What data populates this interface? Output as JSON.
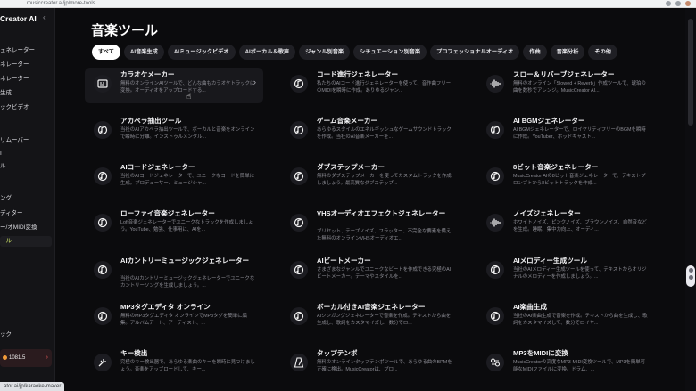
{
  "browser": {
    "url": "musiccreator.ai/jp/more-tools"
  },
  "status_url": "ator.ai/jp/karaoke-maker",
  "sidebar": {
    "brand": "Creator AI",
    "items": [
      {
        "label": "ェネレーター"
      },
      {
        "label": "ネレーター"
      },
      {
        "label": "ネレーター"
      },
      {
        "label": "生成"
      },
      {
        "label": "ックビデオ"
      },
      {
        "label": "リムーバー"
      },
      {
        "label": "I"
      },
      {
        "label": "ル"
      },
      {
        "label": "ング"
      },
      {
        "label": "ディター"
      },
      {
        "label": "ー/オMIDI変換"
      },
      {
        "label": "ール"
      },
      {
        "label": "ック"
      }
    ],
    "credits": "1081.5"
  },
  "main": {
    "title": "音楽ツール",
    "filters": [
      "すべて",
      "AI音楽生成",
      "AIミュージックビデオ",
      "AIボーカル＆歌声",
      "ジャンル別音楽",
      "シチュエーション別音楽",
      "プロフェッショナルオーディオ",
      "作曲",
      "音楽分析",
      "その他"
    ],
    "tools": [
      {
        "title": "カラオケメーカー",
        "desc": "無料のオンラインAIツールで、どんな曲もカラオケトラックに変換。オーディオをアップロードする...",
        "icon": "karaoke-icon"
      },
      {
        "title": "コード進行ジェネレーター",
        "desc": "私たちのAIコード進行ジェネレーターを使って、音作曲フリーのMIDIを瞬時に作成。ありゆるジャン...",
        "icon": "music-note-icon"
      },
      {
        "title": "スロー＆リバーブジェネレーター",
        "desc": "無料のオンライン「Slowed + Reverb」作成ツールで、琥珀の曲を数秒でアレンジ。MusicCreator AI...",
        "icon": "waveform-icon"
      },
      {
        "title": "アカペラ抽出ツール",
        "desc": "当社のAIアカペラ抽出ツールで、ボーカルと音楽をオンラインで瞬時に分離。インストゥルメンタル...",
        "icon": "music-note-icon"
      },
      {
        "title": "ゲーム音楽メーカー",
        "desc": "あらゆるスタイルのエネルギッシュなゲームサウンドトラックを作成。当社のAI音楽メーカーを...",
        "icon": "music-note-icon"
      },
      {
        "title": "AI BGMジェネレーター",
        "desc": "AI BGMジェネレーターで、ロイヤリティフリーのBGMを瞬時に作成。YouTuber、ポッドキャスト...",
        "icon": "music-note-icon"
      },
      {
        "title": "AIコードジェネレーター",
        "desc": "当社のAIコードジェネレーターで、ユニークなコードを簡単に生成。プロデューサー、ミュージシャ...",
        "icon": "music-note-icon"
      },
      {
        "title": "ダブステップメーカー",
        "desc": "無料のダブステップメーカーを使ってカスタムトラックを作成しましょう。最高質なダブステップ...",
        "icon": "music-note-icon"
      },
      {
        "title": "8ビット音楽ジェネレーター",
        "desc": "MusicCreator AIの8ビット音楽ジェネレーターで、テキストプロンプトから8ビットトラックを作成...",
        "icon": "music-note-icon"
      },
      {
        "title": "ローファイ音楽ジェネレーター",
        "desc": "Lofi音楽ジェネレーターでユニークなトラックを作成しましょう。YouTube、勉強、仕事用に、AIを...",
        "icon": "music-note-icon"
      },
      {
        "title": "VHSオーディオエフェクトジェネレーター",
        "desc": "ブリセット、テープノイズ、フラッター、不完全な要素を備えた無料のオンラインVHSオーディオエ...",
        "icon": "music-note-icon"
      },
      {
        "title": "ノイズジェネレーター",
        "desc": "ホワイトノイズ、ピンクノイズ、ブラウンノイズ、自然音などを生成。睡眠、集中力向上、オーディ...",
        "icon": "waveform-icon"
      },
      {
        "title": "AIカントリーミュージックジェネレーター",
        "desc": "当社のAIカントリーミュージックジェネレーターでユニークなカントリーソングを生成しましょう。...",
        "icon": "music-note-icon"
      },
      {
        "title": "AIビートメーカー",
        "desc": "さまざまなジャンルでユニークなビートを作成できる究極のAIビートメーカー。テーマやスタイルを...",
        "icon": "music-note-icon"
      },
      {
        "title": "AIメロディー生成ツール",
        "desc": "当社のAIメロディー生成ツールを使って、テキストからオリジナルのメロディーを作成しましょう。...",
        "icon": "music-note-icon"
      },
      {
        "title": "MP3タグエディタ オンライン",
        "desc": "無料のMP3タグエディタ オンラインでMP3タグを簡単に編集。アルバムアート、アーティスト、...",
        "icon": "music-note-icon"
      },
      {
        "title": "ボーカル付きAI音楽ジェネレーター",
        "desc": "AIシンガングジェネレーターで音楽を作成。テキストから曲を生成し、歌詞をカスタマイズし、数分でロ...",
        "icon": "music-note-icon"
      },
      {
        "title": "AI楽曲生成",
        "desc": "当社のAI楽曲生成で音楽を作成。テキストから曲を生成し、歌詞をカスタマイズして、数分でロイヤ...",
        "icon": "music-note-icon"
      },
      {
        "title": "キー検出",
        "desc": "究極のキー検出器で、あらゆる楽曲のキーを瞬時に見つけましょう。音楽をアップロードして、キー...",
        "icon": "tuning-icon"
      },
      {
        "title": "タップテンポ",
        "desc": "無料のオンラインタップテンポツールで、あらゆる曲のBPMを正確に検出。MusicCreatorは、プロ...",
        "icon": "metronome-icon"
      },
      {
        "title": "MP3をMIDIに変換",
        "desc": "MusicCreatorの高度なMP3-MIDI変換ツールで、MP3を簡単可能なMIDIファイルに変換。ドラム、...",
        "icon": "convert-icon"
      }
    ]
  }
}
